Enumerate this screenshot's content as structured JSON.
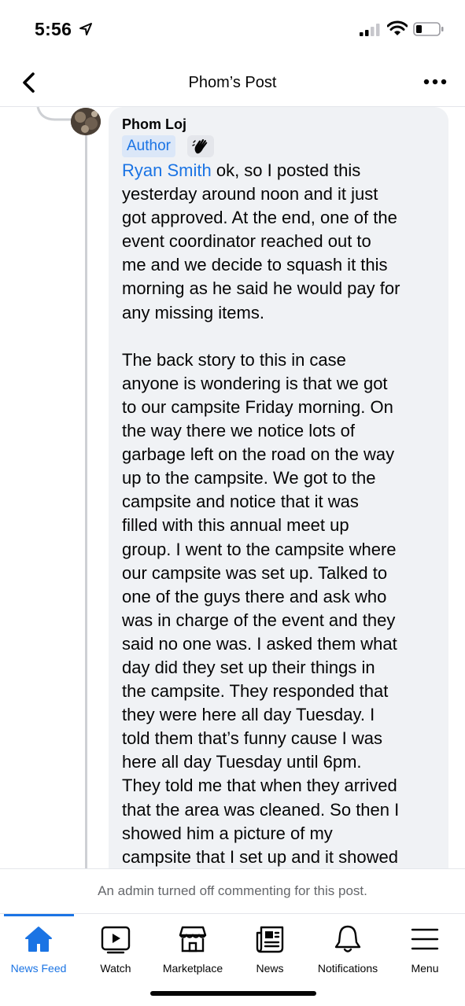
{
  "status_bar": {
    "time": "5:56"
  },
  "header": {
    "title": "Phom’s Post"
  },
  "comment": {
    "author": "Phom Loj",
    "author_badge": "Author",
    "mention": "Ryan Smith",
    "text_after_mention": " ok, so I posted this\nyesterday around noon and it just\ngot approved. At the end, one of the\nevent coordinator reached out to\nme and we decide to squash it this\nmorning as he said he would pay for\nany missing items.\n\nThe back story to this in case\nanyone is wondering is that we got\nto our campsite Friday morning. On\nthe way there we notice lots of\ngarbage left on the road on the way\nup to the campsite. We got to the\ncampsite and notice that it was\nfilled with this annual meet up\ngroup. I went to the campsite where\nour campsite was set up. Talked to\none of the guys there and ask who\nwas in charge of the event and they\nsaid no one was. I asked them what\nday did they set up their things in\nthe campsite. They responded that\nthey were here all day Tuesday. I\ntold them that’s funny cause I was\nhere all day Tuesday until 6pm.\nThey told me that when they arrived\nthat the area was cleaned. So then I\nshowed him a picture of my\ncampsite that I set up and it showed"
  },
  "comment_disabled_notice": "An admin turned off commenting for this post.",
  "tabs": [
    {
      "label": "News Feed",
      "icon": "home-icon",
      "active": true
    },
    {
      "label": "Watch",
      "icon": "watch-icon",
      "active": false
    },
    {
      "label": "Marketplace",
      "icon": "marketplace-icon",
      "active": false
    },
    {
      "label": "News",
      "icon": "news-icon",
      "active": false
    },
    {
      "label": "Notifications",
      "icon": "bell-icon",
      "active": false
    },
    {
      "label": "Menu",
      "icon": "menu-icon",
      "active": false
    }
  ],
  "colors": {
    "accent": "#1b74e4",
    "bubble": "#f0f2f5",
    "secondary_text": "#65676b"
  }
}
